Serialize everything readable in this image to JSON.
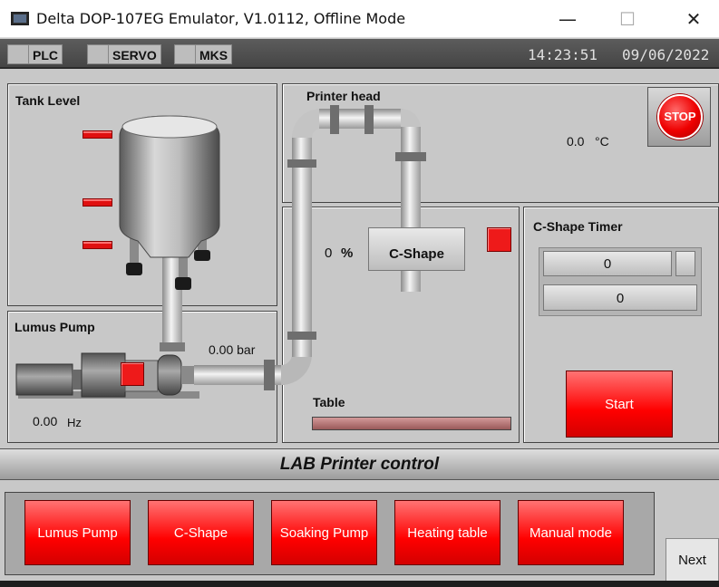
{
  "window": {
    "title": "Delta DOP-107EG Emulator, V1.0112, Offline Mode",
    "minimize": "—",
    "maximize": "☐",
    "close": "✕"
  },
  "status": {
    "plc": "PLC",
    "servo": "SERVO",
    "mks": "MKS",
    "time": "14:23:51",
    "date": "09/06/2022"
  },
  "tank": {
    "label": "Tank Level"
  },
  "printer_head": {
    "label": "Printer head",
    "temp_value": "0.0",
    "temp_unit": "°C",
    "stop": "STOP"
  },
  "middle": {
    "percent_value": "0",
    "percent_unit": "%",
    "cshape_button": "C-Shape",
    "table_label": "Table"
  },
  "timer": {
    "label": "C-Shape Timer",
    "setpoint": "0",
    "value": "0",
    "start": "Start"
  },
  "pump": {
    "label": "Lumus Pump",
    "pressure": "0.00 bar",
    "freq_value": "0.00",
    "freq_unit": "Hz"
  },
  "footer": {
    "title": "LAB Printer control"
  },
  "nav": {
    "buttons": [
      "Lumus Pump",
      "C-Shape",
      "Soaking Pump",
      "Heating table",
      "Manual mode"
    ],
    "next": "Next"
  },
  "colors": {
    "accent_red": "#ee1a1a",
    "header_dark": "#4e4e4e",
    "panel_grey": "#c8c8c8"
  }
}
